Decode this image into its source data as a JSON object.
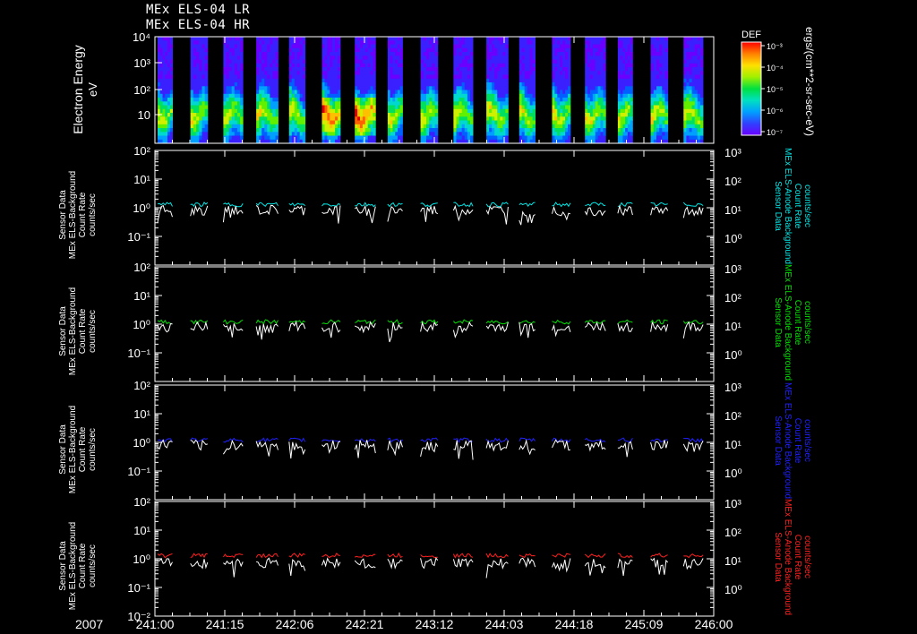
{
  "header": {
    "line1": "MEx ELS-04 LR",
    "line2": "MEx ELS-04 HR"
  },
  "colorbar": {
    "title": "DEF",
    "unit": "ergs/(cm**2-sr-sec-eV)",
    "ticks": [
      "10⁻³",
      "10⁻⁴",
      "10⁻⁵",
      "10⁻⁶",
      "10⁻⁷"
    ]
  },
  "time_axis": {
    "year": "2007",
    "ticks": [
      "241:00",
      "241:15",
      "242:06",
      "242:21",
      "243:12",
      "244:03",
      "244:18",
      "245:09",
      "246:00"
    ]
  },
  "chart_data": [
    {
      "type": "heatmap",
      "ylabel": "Electron Energy",
      "yunit": "eV",
      "yscale": "log",
      "ylim": [
        2,
        10000
      ],
      "left_ticks": [
        "10",
        "10²",
        "10³",
        "10⁴"
      ],
      "data_windows": 17,
      "colormap": "rainbow",
      "note_values": "energy spectrogram; counts shown as differential energy flux"
    },
    {
      "type": "line",
      "left_label": [
        "Sensor Data",
        "MEx ELS-Background",
        "Count Rate",
        "counts/sec"
      ],
      "right_label": [
        "Sensor Data",
        "MEx ELS-Anode Background",
        "Count Rate",
        "counts/sec"
      ],
      "left_ticks": [
        "10²",
        "10¹",
        "10⁰",
        "10⁻¹"
      ],
      "right_ticks": [
        "10³",
        "10²",
        "10¹",
        "10⁰"
      ],
      "ylim": [
        0.01,
        100
      ],
      "yscale": "log",
      "series": [
        {
          "color": "#00e5e5",
          "level": 1.3
        },
        {
          "color": "#ffffff",
          "level": 0.8
        }
      ]
    },
    {
      "type": "line",
      "left_label": [
        "Sensor Data",
        "MEx ELS-Background",
        "Count Rate",
        "counts/sec"
      ],
      "right_label": [
        "Sensor Data",
        "MEx ELS-Anode Background",
        "Count Rate",
        "counts/sec"
      ],
      "left_ticks": [
        "10²",
        "10¹",
        "10⁰",
        "10⁻¹"
      ],
      "right_ticks": [
        "10³",
        "10²",
        "10¹",
        "10⁰"
      ],
      "ylim": [
        0.01,
        100
      ],
      "yscale": "log",
      "series": [
        {
          "color": "#00e000",
          "level": 1.2
        },
        {
          "color": "#ffffff",
          "level": 0.8
        }
      ]
    },
    {
      "type": "line",
      "left_label": [
        "Sensor Data",
        "MEx ELS-Background",
        "Count Rate",
        "counts/sec"
      ],
      "right_label": [
        "Sensor Data",
        "MEx ELS-Anode Background",
        "Count Rate",
        "counts/sec"
      ],
      "left_ticks": [
        "10²",
        "10¹",
        "10⁰",
        "10⁻¹"
      ],
      "right_ticks": [
        "10³",
        "10²",
        "10¹",
        "10⁰"
      ],
      "ylim": [
        0.01,
        100
      ],
      "yscale": "log",
      "series": [
        {
          "color": "#2020ff",
          "level": 1.2
        },
        {
          "color": "#ffffff",
          "level": 0.8
        }
      ]
    },
    {
      "type": "line",
      "left_label": [
        "Sensor Data",
        "MEx ELS-Background",
        "Count Rate",
        "counts/sec"
      ],
      "right_label": [
        "Sensor Data",
        "MEx ELS-Anode Background",
        "Count Rate",
        "counts/sec"
      ],
      "left_ticks": [
        "10²",
        "10¹",
        "10⁰",
        "10⁻¹",
        "10⁻²"
      ],
      "right_ticks": [
        "10³",
        "10²",
        "10¹",
        "10⁰"
      ],
      "ylim": [
        0.01,
        100
      ],
      "yscale": "log",
      "series": [
        {
          "color": "#ff2020",
          "level": 1.3
        },
        {
          "color": "#ffffff",
          "level": 0.7
        }
      ]
    }
  ]
}
